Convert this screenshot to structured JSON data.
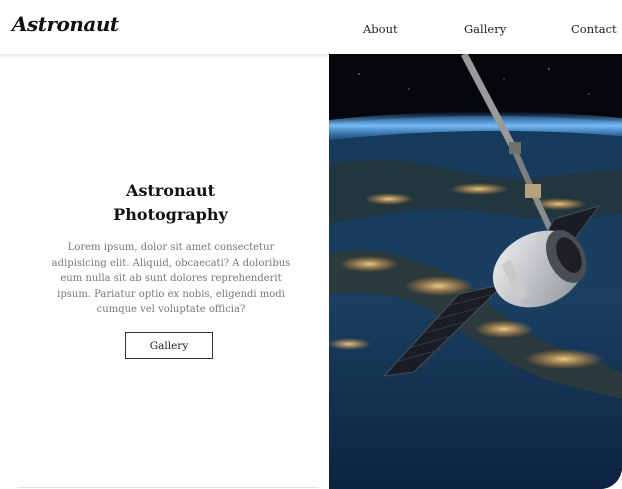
{
  "header": {
    "logo": "Astronaut",
    "nav": [
      {
        "label": "About"
      },
      {
        "label": "Gallery"
      },
      {
        "label": "Contact"
      }
    ]
  },
  "hero": {
    "title_line1": "Astronaut",
    "title_line2": "Photography",
    "description": "Lorem ipsum, dolor sit amet consectetur adipisicing elit. Aliquid, obcaecati? A doloribus eum nulla sit ab sunt dolores reprehenderit ipsum. Pariatur optio ex nobis, eligendi modi cumque vel voluptate officia?",
    "button_label": "Gallery",
    "image_subject": "space-capsule-over-earth-at-night"
  }
}
